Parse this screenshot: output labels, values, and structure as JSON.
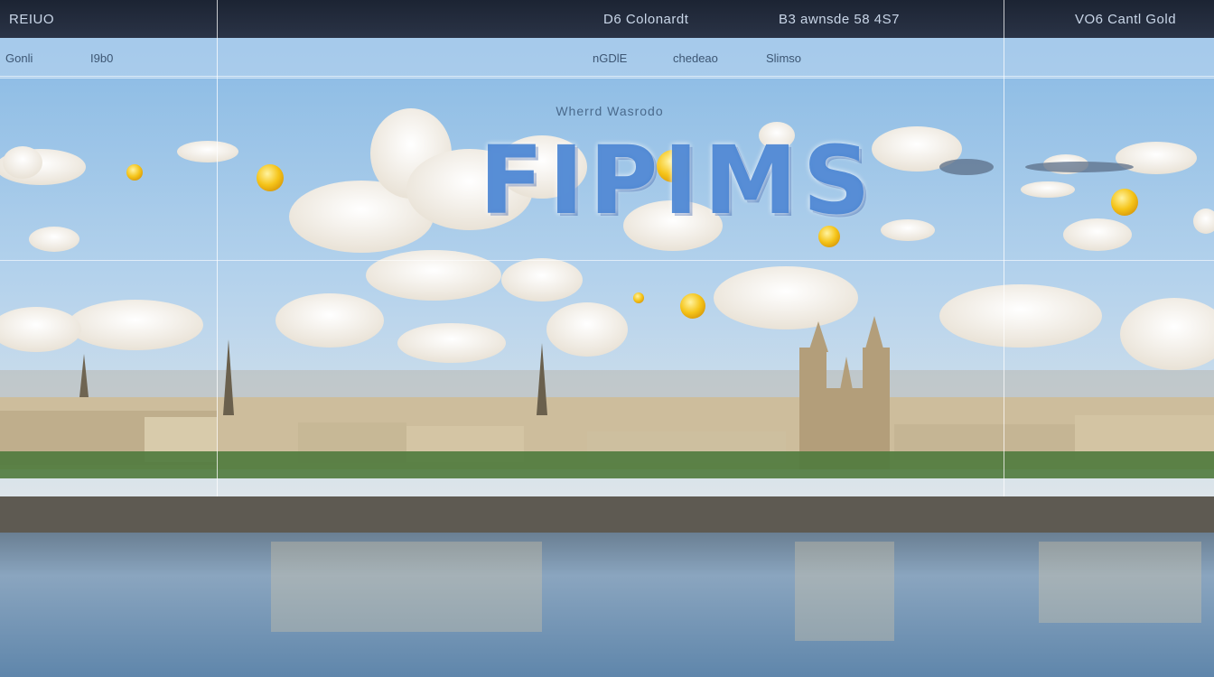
{
  "topbar": {
    "left_label": "REIUO",
    "center_label_1": "D6 Colonardt",
    "center_label_2": "B3 awnsde 58 4S7",
    "right_label": "VO6 Cantl Gold"
  },
  "subbar": {
    "left_label_1": "Gonli",
    "left_label_2": "I9b0",
    "center_label_1": "nGDlE",
    "center_label_2": "chedeao",
    "center_label_3": "Slimso"
  },
  "banner": {
    "subtitle": "Wherrd Wasrodo",
    "title": "FIPIMS"
  },
  "colors": {
    "sky_top": "#8fbde6",
    "sky_bottom": "#d5e3ee",
    "water": "#7d9cba",
    "sun": "#f4c21b",
    "title_blue": "#4682d2"
  }
}
